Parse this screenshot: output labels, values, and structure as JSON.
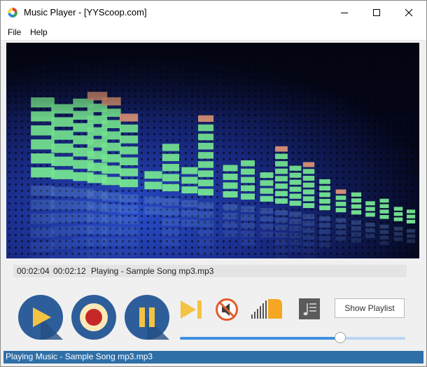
{
  "window": {
    "title": "Music Player - [YYScoop.com]",
    "accent": "#2f6fa7"
  },
  "menu": {
    "items": [
      {
        "label": "File"
      },
      {
        "label": "Help"
      }
    ]
  },
  "player": {
    "elapsed": "00:02:04",
    "duration": "00:02:12",
    "now_playing": "Playing - Sample Song mp3.mp3",
    "volume_fraction": 0.71,
    "icons": [
      "play-icon",
      "record-icon",
      "pause-icon",
      "skip-next-icon",
      "mute-icon",
      "volume-level-icon",
      "playlist-music-icon"
    ],
    "playlist_button": "Show Playlist"
  },
  "status_bar": {
    "text": "Playing Music - Sample Song mp3.mp3"
  }
}
